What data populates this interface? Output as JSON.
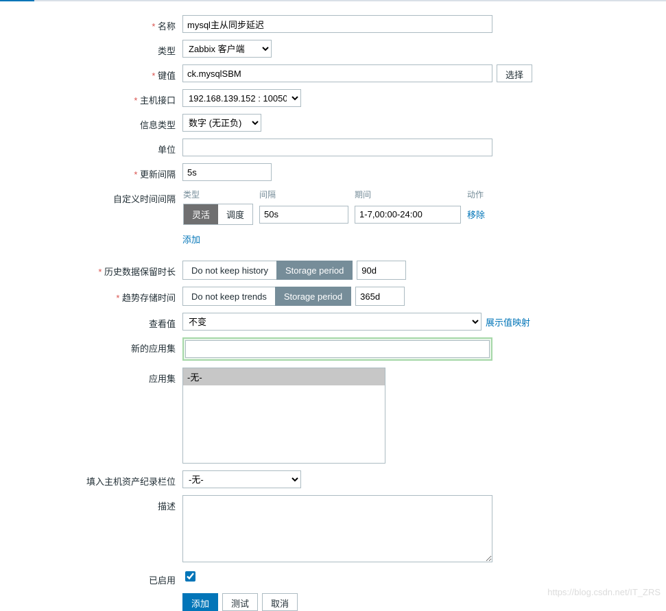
{
  "labels": {
    "name": "名称",
    "type": "类型",
    "key": "键值",
    "host_interface": "主机接口",
    "info_type": "信息类型",
    "unit": "单位",
    "update_interval": "更新间隔",
    "custom_intervals": "自定义时间间隔",
    "history": "历史数据保留时长",
    "trends": "趋势存储时间",
    "show_value": "查看值",
    "new_appset": "新的应用集",
    "appset": "应用集",
    "inventory": "填入主机资产纪录栏位",
    "description": "描述",
    "enabled": "已启用"
  },
  "values": {
    "name": "mysql主从同步延迟",
    "type": "Zabbix 客户端",
    "key": "ck.mysqlSBM",
    "host_interface": "192.168.139.152 : 10050",
    "info_type": "数字 (无正负)",
    "unit": "",
    "update_interval": "5s",
    "history_period": "90d",
    "trends_period": "365d",
    "show_value": "不变",
    "appset_none": "-无-",
    "inventory": "-无-",
    "description": "",
    "enabled": true
  },
  "interval": {
    "col_type": "类型",
    "col_interval": "间隔",
    "col_period": "期间",
    "col_action": "动作",
    "flexible": "灵活",
    "scheduled": "调度",
    "interval_val": "50s",
    "period_val": "1-7,00:00-24:00",
    "remove": "移除",
    "add": "添加"
  },
  "storage": {
    "do_not_keep_history": "Do not keep history",
    "do_not_keep_trends": "Do not keep trends",
    "storage_period": "Storage period"
  },
  "buttons": {
    "select": "选择",
    "show_value_mappings": "展示值映射",
    "add": "添加",
    "test": "测试",
    "cancel": "取消"
  },
  "watermark": "https://blog.csdn.net/IT_ZRS"
}
